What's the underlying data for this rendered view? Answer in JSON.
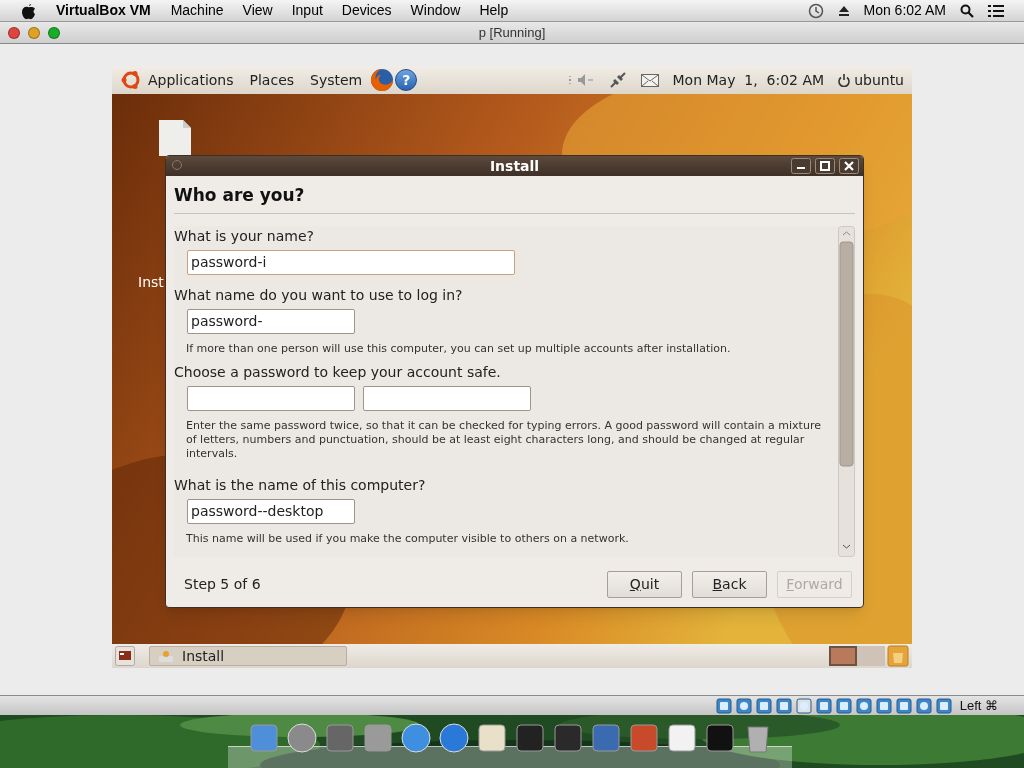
{
  "mac_menubar": {
    "app": "VirtualBox VM",
    "menus": [
      "Machine",
      "View",
      "Input",
      "Devices",
      "Window",
      "Help"
    ],
    "clock": "Mon 6:02 AM"
  },
  "window": {
    "title": "p [Running]"
  },
  "ubuntu_panel": {
    "menus": [
      "Applications",
      "Places",
      "System"
    ],
    "help": "?",
    "clock": "Mon May  1,  6:02 AM",
    "user": "ubuntu"
  },
  "desktop": {
    "icons": [
      {
        "label": "Inst"
      }
    ]
  },
  "dialog": {
    "title": "Install",
    "heading": "Who are you?",
    "sections": [
      {
        "label": "What is your name?",
        "fields": [
          {
            "value": "password-i",
            "wide": true,
            "focused": true
          }
        ]
      },
      {
        "label": "What name do you want to use to log in?",
        "fields": [
          {
            "value": "password-",
            "wide": false,
            "focused": false
          }
        ],
        "hint": "If more than one person will use this computer, you can set up multiple accounts after installation."
      },
      {
        "label": "Choose a password to keep your account safe.",
        "fields": [
          {
            "wide": false,
            "focused": false
          },
          {
            "wide": false,
            "focused": false
          }
        ],
        "hint": "Enter the same password twice, so that it can be checked for typing errors. A good password will contain a mixture of letters, numbers and punctuation, should be at least eight characters long, and should be changed at regular intervals."
      },
      {
        "label": "What is the name of this computer?",
        "fields": [
          {
            "value": "password--desktop",
            "wide": false,
            "focused": false
          }
        ],
        "hint": "This name will be used if you make the computer visible to others on a network."
      }
    ],
    "step": "Step 5 of 6",
    "buttons": [
      {
        "label": "Quit",
        "disabled": false
      },
      {
        "label": "Back",
        "disabled": false
      },
      {
        "label": "Forward",
        "disabled": true
      }
    ]
  },
  "taskbar": {
    "items": [
      {
        "label": "Install"
      }
    ]
  },
  "status_bar": {
    "host_key": "Left ⌘"
  }
}
